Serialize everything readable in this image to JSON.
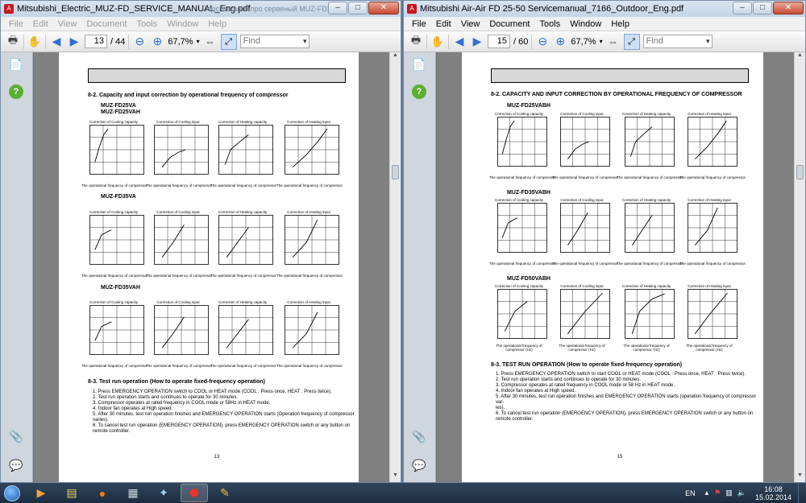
{
  "left_window": {
    "title": "Mitsubishi_Electric_MUZ-FD_SERVICE_MANUAL_Eng.pdf",
    "background_tab_title": "Подсказкаоте про сервеный MUZ-FD25VA+",
    "menu": [
      "File",
      "Edit",
      "View",
      "Document",
      "Tools",
      "Window",
      "Help"
    ],
    "page_current": "13",
    "page_total": "/ 44",
    "zoom": "67,7%",
    "find_placeholder": "Find",
    "page": {
      "section_title": "8-2. Capacity and input correction by operational frequency of compressor",
      "model_1": "MUZ-FD25VA",
      "model_1b": "MUZ-FD25VAH",
      "model_2": "MUZ-FD35VA",
      "model_3": "MUZ-FD35VAH",
      "chart_titles": [
        "Correction of Cooling capacity",
        "Correction of Cooling input",
        "Correction of Heating capacity",
        "Correction of Heating input"
      ],
      "x_axis_label": "The operational frequency of compressor",
      "y_labels": [
        "Capacity correction factors",
        "Input correction factors",
        "Capacity correction factors",
        "Input correction factors"
      ],
      "y_ticks": [
        "0",
        "0.5",
        "1.0",
        "1.5"
      ],
      "y_ticks_heat_input": [
        "0",
        "1.0",
        "2.0",
        "3.0",
        "4.0"
      ],
      "x_ticks": [
        "0",
        "50",
        "100",
        "150(Hz)"
      ],
      "test_run_title": "8-3. Test run operation (How to operate fixed-frequency operation)",
      "test_run_steps": [
        "1. Press EMERGENCY OPERATION switch to COOL or HEAT mode (COOL : Press once, HEAT : Press twice).",
        "2. Test run operation starts and continues to operate for 30 minutes.",
        "3. Compressor operates at rated frequency in COOL mode or 58Hz in HEAT mode.",
        "4. Indoor fan operates at High speed.",
        "5. After 30 minutes, test run operation finishes and EMERGENCY OPERATION starts (Operation frequency of compressor",
        "   varies).",
        "6. To cancel test run operation (EMERGENCY OPERATION), press EMERGENCY OPERATION switch or any button on",
        "   remote controller."
      ],
      "page_number": "13"
    }
  },
  "right_window": {
    "title": "Mitsubishi Air-Air FD 25-50 Servicemanual_7166_Outdoor_Eng.pdf",
    "menu": [
      "File",
      "Edit",
      "View",
      "Document",
      "Tools",
      "Window",
      "Help"
    ],
    "page_current": "15",
    "page_total": "/ 60",
    "zoom": "67,7%",
    "find_placeholder": "Find",
    "page": {
      "section_title": "8-2. CAPACITY AND INPUT CORRECTION BY OPERATIONAL FREQUENCY OF COMPRESSOR",
      "model_1": "MUZ-FD25VABH",
      "model_2": "MUZ-FD35VABH",
      "model_3": "MUZ-FD50VABH",
      "chart_titles": [
        "Correction of Cooling capacity",
        "Correction of Cooling input",
        "Correction of Heating capacity",
        "Correction of Heating input"
      ],
      "x_axis_label": "The operational frequency of compressor",
      "x_axis_label_r3a": "The operational frequency of",
      "x_axis_label_r3b": "compressor (Hz)",
      "test_run_title": "8-3. TEST RUN OPERATION (How to operate fixed-frequency operation)",
      "test_run_steps": [
        "1. Press EMERGENCY OPERATION switch to start COOL or HEAT mode (COOL : Press once, HEAT : Press twice).",
        "2. Test run operation starts and continues to operate for 30 minutes.",
        "3. Compressor operates at rated frequency in COOL mode or 58 Hz in HEAT mode.",
        "4. Indoor fan operates at High speed.",
        "5. After 30 minutes, test run operation finishes and EMERGENCY OPERATION starts (operation frequency of compressor var-",
        "   ies).",
        "6. To cancel test run operation (EMERGENCY OPERATION), press EMERGENCY OPERATION switch or any button on",
        "   remote controller."
      ],
      "page_number": "15"
    }
  },
  "taskbar": {
    "language": "EN",
    "time": "16:08",
    "date": "15.02.2014"
  },
  "colors": {
    "titlebar": "#c5d4e6",
    "taskbar": "#1d2d40",
    "acrobat_red": "#c8151b"
  }
}
